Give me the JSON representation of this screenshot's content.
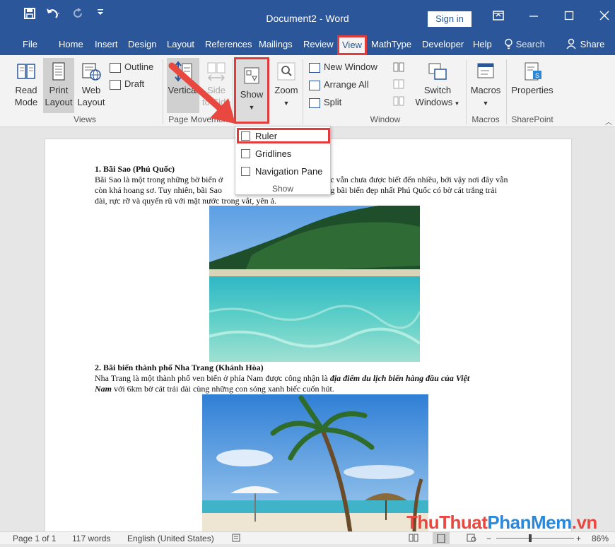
{
  "titlebar": {
    "save_icon": "save-icon",
    "undo_icon": "undo-icon",
    "redo_icon": "redo-icon",
    "customize_icon": "customize-qat-icon",
    "title": "Document2 - Word",
    "sign_in": "Sign in",
    "ribbon_display_icon": "ribbon-display-icon",
    "minimize_icon": "minimize-icon",
    "maximize_icon": "maximize-icon",
    "close_icon": "close-icon"
  },
  "tabs": {
    "file": "File",
    "home": "Home",
    "insert": "Insert",
    "design": "Design",
    "layout": "Layout",
    "references": "References",
    "mailings": "Mailings",
    "review": "Review",
    "view": "View",
    "mathtype": "MathType",
    "developer": "Developer",
    "help": "Help",
    "search": "Search",
    "share": "Share"
  },
  "ribbon": {
    "views": {
      "read_mode_line1": "Read",
      "read_mode_line2": "Mode",
      "print_layout_line1": "Print",
      "print_layout_line2": "Layout",
      "web_layout_line1": "Web",
      "web_layout_line2": "Layout",
      "outline": "Outline",
      "draft": "Draft",
      "group_label": "Views"
    },
    "page_movement": {
      "vertical": "Vertical",
      "side_to_side_line1": "Side",
      "side_to_side_line2": "to Side",
      "group_label": "Page Movement"
    },
    "show": {
      "label": "Show"
    },
    "zoom": {
      "label": "Zoom"
    },
    "window": {
      "new_window": "New Window",
      "arrange_all": "Arrange All",
      "split": "Split",
      "switch_line1": "Switch",
      "switch_line2": "Windows",
      "group_label": "Window"
    },
    "macros": {
      "label": "Macros",
      "group_label": "Macros"
    },
    "sharepoint": {
      "label": "Properties",
      "group_label": "SharePoint"
    }
  },
  "dropdown": {
    "ruler": "Ruler",
    "gridlines": "Gridlines",
    "navigation_pane": "Navigation Pane",
    "group_label": "Show"
  },
  "document": {
    "heading1": "1. Bãi Sao (Phú Quốc)",
    "para1_line1_a": "Bãi Sao là  một trong những bờ biển ở",
    "para1_line1_b": "uốc vẫn chưa được biết đến nhiều, bởi vậy nơi đây vẫn",
    "para1_line2_a": "còn khá hoang sơ. Tuy nhiên, bãi Sao",
    "para1_line2_b": "hững bãi biển đẹp nhất  Phú Quốc có bờ cát trắng trải",
    "para1_line3": "dài, rực rỡ và quyến rũ với mặt nước trong vắt, yên ả.",
    "heading2": "2. Bãi biển thành phố Nha Trang (Khánh Hòa)",
    "para2_a": "Nha Trang là một thành phố ven biển ở phía Nam được công nhận là ",
    "para2_bold1": "địa điểm du lịch biển hàng đầu của Việt",
    "para2_bold2": "Nam",
    "para2_c": " với 6km bờ cát trải dài cùng những con sóng xanh biếc cuốn hút."
  },
  "status": {
    "page": "Page 1 of 1",
    "words": "117 words",
    "language": "English (United States)",
    "zoom": "86%"
  },
  "watermark": {
    "part1": "ThuThuat",
    "part2": "PhanMem",
    "part3": ".vn"
  },
  "colors": {
    "word_blue": "#2b579a",
    "highlight_red": "#e03c3c"
  }
}
